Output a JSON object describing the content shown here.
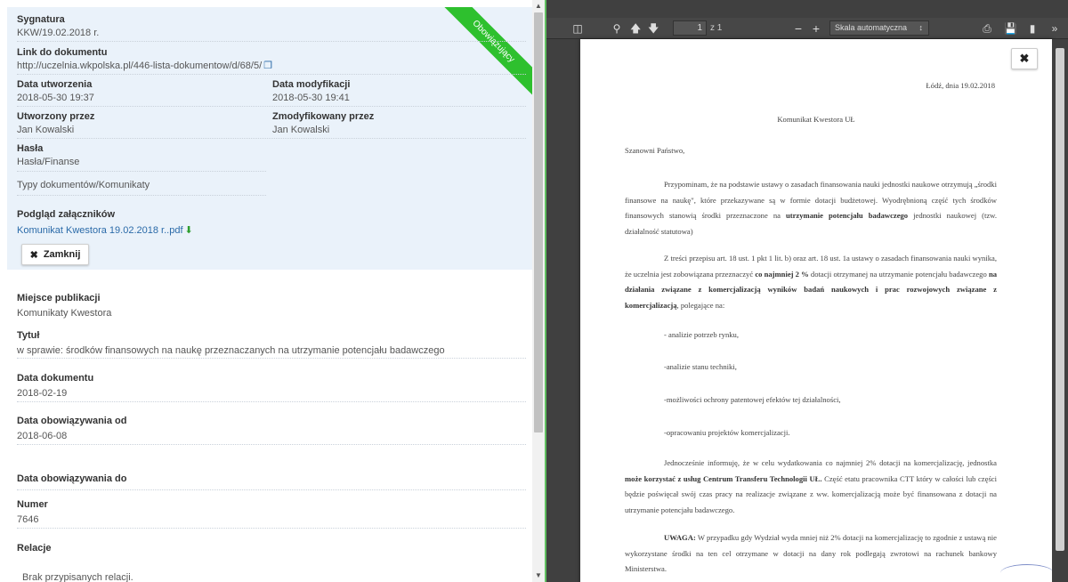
{
  "info": {
    "status_ribbon": "Obowiązujący",
    "sygnatura_label": "Sygnatura",
    "sygnatura_value": "KKW/19.02.2018 r.",
    "link_label": "Link do dokumentu",
    "link_value": "http://uczelnia.wkpolska.pl/446-lista-dokumentow/d/68/5/",
    "created_label": "Data utworzenia",
    "created_value": "2018-05-30 19:37",
    "modified_label": "Data modyfikacji",
    "modified_value": "2018-05-30 19:41",
    "created_by_label": "Utworzony przez",
    "created_by_value": "Jan Kowalski",
    "modified_by_label": "Zmodyfikowany przez",
    "modified_by_value": "Jan Kowalski",
    "tags_label": "Hasła",
    "tags_value": "Hasła/Finanse",
    "types_value": "Typy dokumentów/Komunikaty",
    "attachments_label": "Podgląd załączników",
    "attachment_file": "Komunikat Kwestora 19.02.2018 r..pdf",
    "close_label": "Zamknij"
  },
  "meta": {
    "place_label": "Miejsce publikacji",
    "place_value": "Komunikaty Kwestora",
    "title_label": "Tytuł",
    "title_value": "w sprawie: środków finansowych na naukę przeznaczanych na utrzymanie potencjału badawczego",
    "doc_date_label": "Data dokumentu",
    "doc_date_value": "2018-02-19",
    "valid_from_label": "Data obowiązywania od",
    "valid_from_value": "2018-06-08",
    "valid_to_label": "Data obowiązywania do",
    "number_label": "Numer",
    "number_value": "7646",
    "relations_label": "Relacje",
    "relations_value": "Brak przypisanych relacji."
  },
  "viewer": {
    "page_number": "1",
    "page_of": "z 1",
    "zoom_label": "Skala automatyczna",
    "icons": [
      "sidebar-toggle-icon",
      "search-icon",
      "arrow-up-icon",
      "arrow-down-icon",
      "zoom-out-icon",
      "zoom-in-icon",
      "print-icon",
      "download-icon",
      "bookmark-icon",
      "more-icon"
    ]
  },
  "pdf": {
    "date_line": "Łódź, dnia 19.02.2018",
    "heading": "Komunikat Kwestora UŁ",
    "salutation": "Szanowni Państwo,",
    "p1a": "Przypominam, że na podstawie ustawy o zasadach finansowania nauki jednostki naukowe otrzymują „środki finansowe na naukę\", które przekazywane są w formie dotacji budżetowej. Wyodrębnioną część tych środków finansowych stanowią środki przeznaczone na",
    "p1b": "utrzymanie potencjału badawczego",
    "p1c": "jednostki naukowej (tzw. działalność statutowa)",
    "p2a": "Z treści przepisu art. 18 ust. 1 pkt 1 lit. b) oraz art. 18 ust. 1a ustawy o zasadach finansowania nauki wynika, że uczelnia jest zobowiązana przeznaczyć",
    "p2b": "co najmniej 2 %",
    "p2c": "dotacji otrzymanej na utrzymanie potencjału badawczego",
    "p2d": "na działania związane z komercjalizacją wyników badań naukowych i prac rozwojowych związane z komercjalizacją",
    "p2e": ", polegające na:",
    "b1": "- analizie potrzeb rynku,",
    "b2": "-analizie stanu techniki,",
    "b3": "-możliwości ochrony patentowej efektów tej działalności,",
    "b4": "-opracowaniu projektów komercjalizacji.",
    "p3a": "Jednocześnie informuję, że w celu wydatkowania co najmniej 2% dotacji na komercjalizację, jednostka",
    "p3b": "może korzystać z usług Centrum Transferu Technologii UŁ.",
    "p3c": "Część etatu pracownika CTT który w całości lub części będzie poświęcał swój czas pracy na realizacje związane z ww. komercjalizacją może być finansowana z dotacji na utrzymanie potencjału badawczego.",
    "p4a": "UWAGA:",
    "p4b": "W przypadku gdy Wydział wyda mniej niż 2% dotacji na komercjalizację to zgodnie z ustawą nie wykorzystane środki na ten cel otrzymane w dotacji na dany rok podlegają zwrotowi na rachunek bankowy Ministerstwa."
  }
}
